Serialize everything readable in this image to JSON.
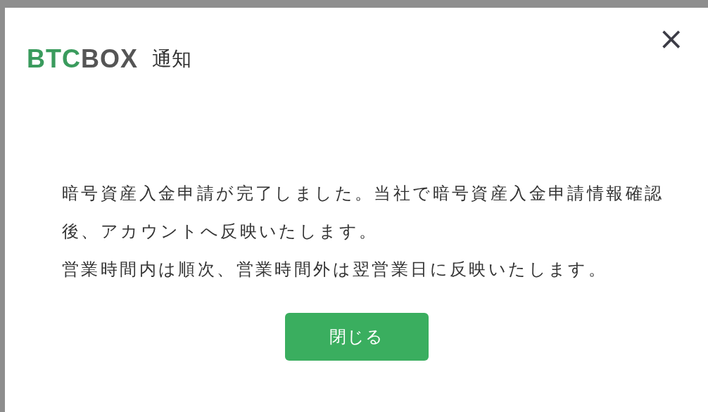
{
  "logo": [
    {
      "text": "BTC",
      "color": "#3a9b5d"
    },
    {
      "text": "BOX",
      "color": "#555555"
    }
  ],
  "title": "通知",
  "close": "×",
  "message": [
    "暗号資産入金申請が完了しました。当社で暗号資産入金申請情報確認後、アカウントへ反映いたします。",
    "営業時間内は順次、営業時間外は翌営業日に反映いたします。"
  ],
  "button": "閉じる"
}
